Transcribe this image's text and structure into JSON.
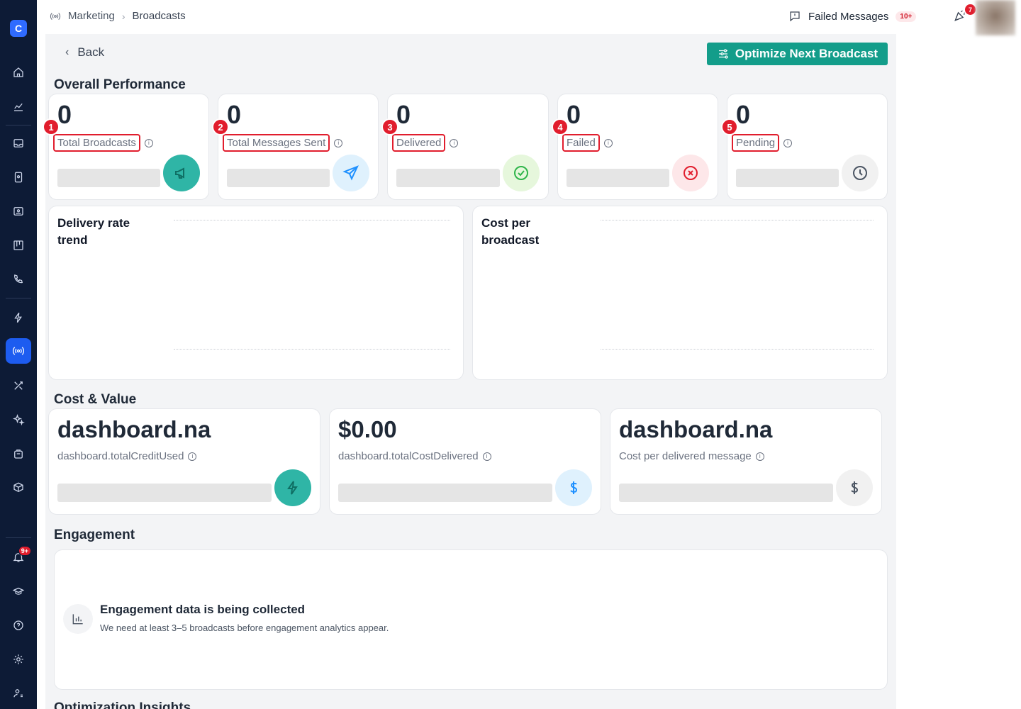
{
  "app": {
    "logo_letter": "C"
  },
  "leftnav": {
    "items": [
      {
        "icon": "home-icon"
      },
      {
        "icon": "analytics-icon"
      },
      {
        "icon": "inbox-icon"
      },
      {
        "icon": "contacts-book-icon"
      },
      {
        "icon": "contact-card-icon"
      },
      {
        "icon": "kanban-icon"
      },
      {
        "icon": "phone-icon"
      },
      {
        "icon": "lightning-icon"
      },
      {
        "icon": "broadcast-icon",
        "active": true
      },
      {
        "icon": "tools-icon"
      },
      {
        "icon": "sparkles-icon"
      },
      {
        "icon": "briefcase-icon"
      },
      {
        "icon": "package-settings-icon"
      }
    ],
    "bottom": [
      {
        "icon": "bell-icon",
        "badge": "9+"
      },
      {
        "icon": "graduation-icon"
      },
      {
        "icon": "help-icon"
      },
      {
        "icon": "settings-icon"
      },
      {
        "icon": "user-settings-icon"
      }
    ]
  },
  "topbar": {
    "breadcrumb": [
      "Marketing",
      "Broadcasts"
    ],
    "failed_messages_label": "Failed Messages",
    "failed_messages_badge": "10+",
    "notifications_count": "7"
  },
  "page": {
    "back_label": "Back",
    "optimize_button": "Optimize Next Broadcast",
    "overall_title": "Overall Performance",
    "cost_title": "Cost & Value",
    "engagement_title": "Engagement",
    "insights_title": "Optimization Insights"
  },
  "stats": [
    {
      "marker": "1",
      "value": "0",
      "label": "Total Broadcasts",
      "icon": "megaphone-icon",
      "color": "#2fb5a6",
      "bg": "#2fb5a6"
    },
    {
      "marker": "2",
      "value": "0",
      "label": "Total Messages Sent",
      "icon": "send-icon",
      "color": "#1e90ff",
      "bg": "#dff1fd"
    },
    {
      "marker": "3",
      "value": "0",
      "label": "Delivered",
      "icon": "check-circle-icon",
      "color": "#2fb54a",
      "bg": "#e6f7dc"
    },
    {
      "marker": "4",
      "value": "0",
      "label": "Failed",
      "icon": "x-circle-icon",
      "color": "#e11d2d",
      "bg": "#fde7e9"
    },
    {
      "marker": "5",
      "value": "0",
      "label": "Pending",
      "icon": "clock-icon",
      "color": "#4b5563",
      "bg": "#f1f1f1"
    }
  ],
  "charts": [
    {
      "title": "Delivery rate trend"
    },
    {
      "title": "Cost per broadcast"
    }
  ],
  "cost_cards": [
    {
      "value": "dashboard.na",
      "label": "dashboard.totalCreditUsed",
      "icon": "lightning-icon"
    },
    {
      "value": "$0.00",
      "label": "dashboard.totalCostDelivered",
      "icon": "dollar-icon"
    },
    {
      "value": "dashboard.na",
      "label": "Cost per delivered message",
      "icon": "dollar-icon"
    }
  ],
  "engagement": {
    "title": "Engagement data is being collected",
    "subtitle": "We need at least 3–5 broadcasts before engagement analytics appear."
  }
}
